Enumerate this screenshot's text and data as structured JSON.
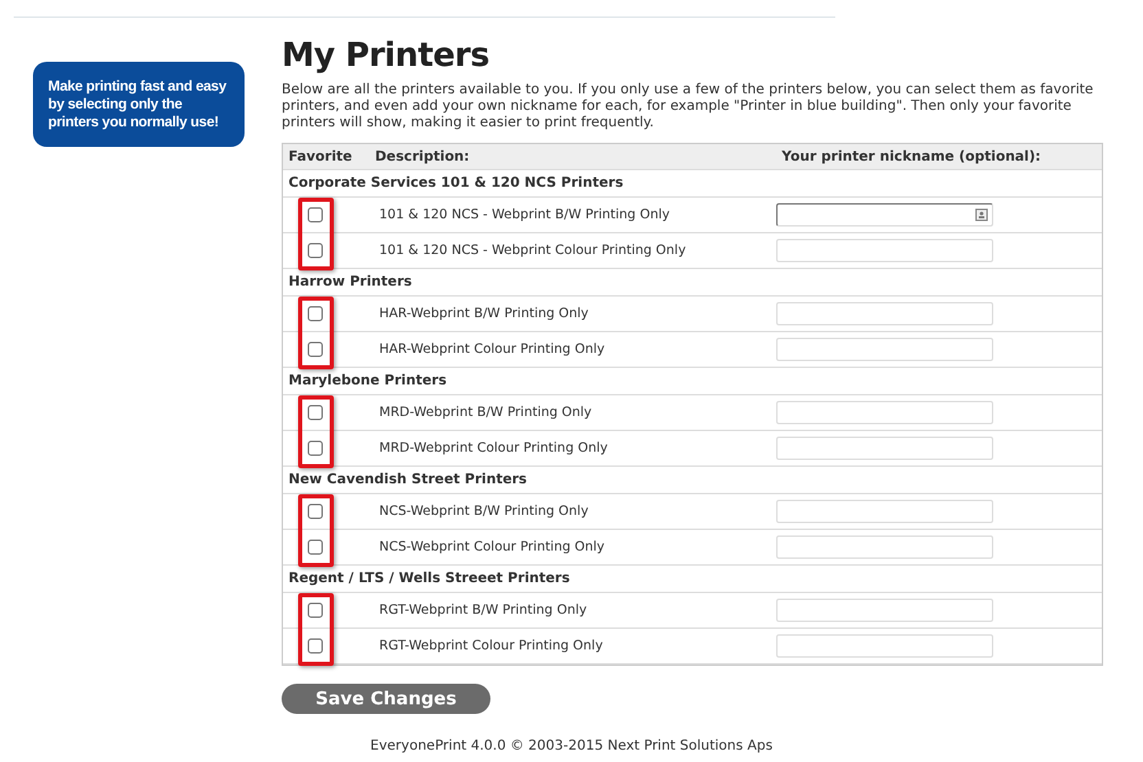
{
  "promo": "Make printing fast and easy by selecting only the printers you normally use!",
  "title": "My Printers",
  "intro": "Below are all the printers available to you. If you only use a few of the printers below, you can select them as favorite printers, and even add your own nickname for each, for example \"Printer in blue building\". Then only your favorite printers will show, making it easier to print frequently.",
  "table": {
    "columns": [
      "Favorite",
      "Description:",
      "Your printer nickname (optional):"
    ],
    "groups": [
      {
        "name": "Corporate Services 101 & 120 NCS Printers",
        "highlighted": true,
        "printers": [
          {
            "description": "101 & 120 NCS - Webprint B/W Printing Only",
            "checked": false,
            "focused": true
          },
          {
            "description": "101 & 120 NCS - Webprint Colour Printing Only",
            "checked": false,
            "focused": false
          }
        ]
      },
      {
        "name": "Harrow Printers",
        "highlighted": true,
        "printers": [
          {
            "description": "HAR-Webprint B/W Printing Only",
            "checked": false,
            "focused": false
          },
          {
            "description": "HAR-Webprint Colour Printing Only",
            "checked": false,
            "focused": false
          }
        ]
      },
      {
        "name": "Marylebone Printers",
        "highlighted": true,
        "printers": [
          {
            "description": "MRD-Webprint B/W Printing Only",
            "checked": false,
            "focused": false
          },
          {
            "description": "MRD-Webprint Colour Printing Only",
            "checked": false,
            "focused": false
          }
        ]
      },
      {
        "name": "New Cavendish Street Printers",
        "highlighted": true,
        "printers": [
          {
            "description": "NCS-Webprint B/W Printing Only",
            "checked": false,
            "focused": false
          },
          {
            "description": "NCS-Webprint Colour Printing Only",
            "checked": false,
            "focused": false
          }
        ]
      },
      {
        "name": "Regent / LTS / Wells Streeet Printers",
        "highlighted": true,
        "printers": [
          {
            "description": "RGT-Webprint B/W Printing Only",
            "checked": false,
            "focused": false
          },
          {
            "description": "RGT-Webprint Colour Printing Only",
            "checked": false,
            "focused": false
          }
        ]
      }
    ]
  },
  "save_button": "Save Changes",
  "footer": [
    "EveryonePrint 4.0.0 © 2003-2015 Next Print Solutions Aps"
  ]
}
